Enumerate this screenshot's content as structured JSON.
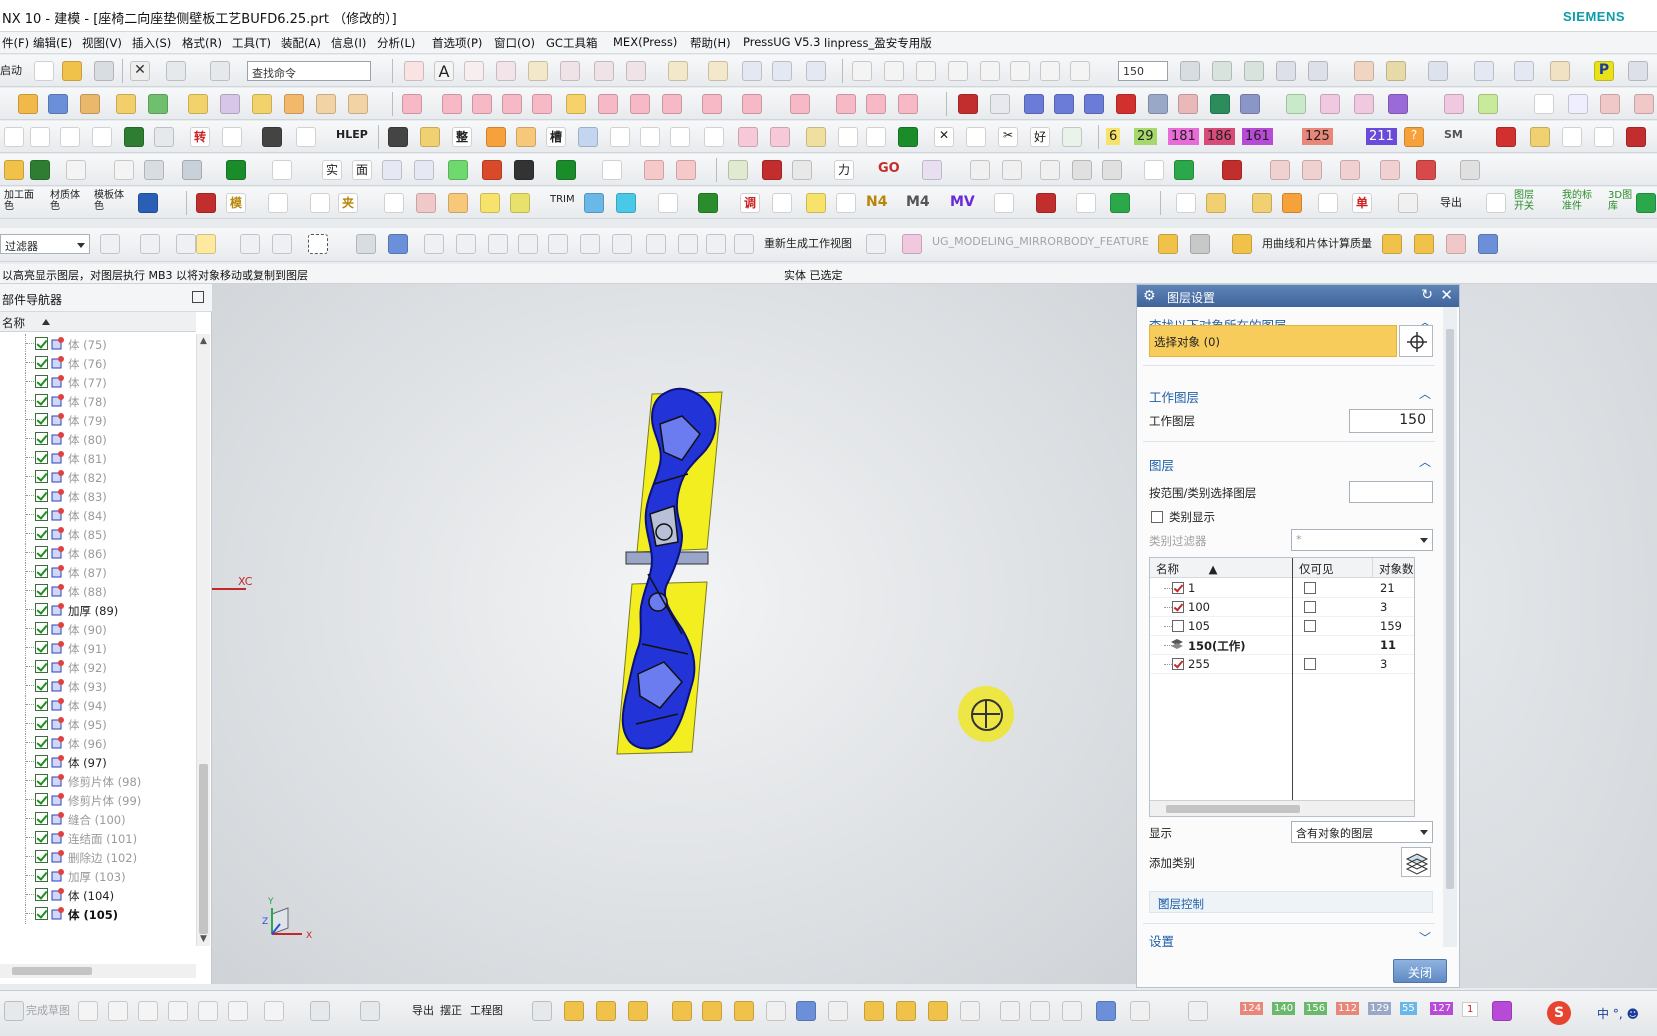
{
  "window": {
    "title": "NX 10 - 建模 - [座椅二向座垫侧壁板工艺BUFD6.25.prt （修改的）]",
    "brand": "SIEMENS"
  },
  "menu": [
    "件(F)",
    "编辑(E)",
    "视图(V)",
    "插入(S)",
    "格式(R)",
    "工具(T)",
    "装配(A)",
    "信息(I)",
    "分析(L)",
    "首选项(P)",
    "窗口(O)",
    "GC工具箱",
    "MEX(Press)",
    "帮助(H)",
    "PressUG V5.3",
    "linpress_盈安专用版"
  ],
  "toolbar": {
    "start_label": "启动",
    "command_search_placeholder": "查找命令",
    "work_layer_combo": "150",
    "filter_combo": "过滤器",
    "regenerate_label": "重新生成工作视图",
    "mirror_feature_label": "UG_MODELING_MIRRORBODY_FEATURE",
    "compute_mass_label": "用曲线和片体计算质量",
    "row2_labels": [
      "加工面色",
      "材质体色",
      "模板体色"
    ],
    "hlep_label": "HLEP",
    "n4": "N4",
    "m4": "M4",
    "mv": "MV",
    "go": "GO",
    "sm": "SM",
    "trim": "TRIM",
    "p": "P",
    "export_label": "导出",
    "layer_switch_label": "图层开关",
    "standard_label": "我的标准件",
    "lib3d_label": "3D图库",
    "numbers": [
      "6",
      "29",
      "181",
      "186",
      "161",
      "125",
      "211"
    ]
  },
  "status": {
    "message": "以高亮显示图层，对图层执行 MB3 以将对象移动或复制到图层",
    "selection": "实体 已选定"
  },
  "navigator": {
    "title": "部件导航器",
    "column": "名称",
    "items": [
      {
        "label": "体 (75)",
        "style": "dim"
      },
      {
        "label": "体 (76)",
        "style": "dim"
      },
      {
        "label": "体 (77)",
        "style": "dim"
      },
      {
        "label": "体 (78)",
        "style": "dim"
      },
      {
        "label": "体 (79)",
        "style": "dim"
      },
      {
        "label": "体 (80)",
        "style": "dim"
      },
      {
        "label": "体 (81)",
        "style": "dim"
      },
      {
        "label": "体 (82)",
        "style": "dim"
      },
      {
        "label": "体 (83)",
        "style": "dim"
      },
      {
        "label": "体 (84)",
        "style": "dim"
      },
      {
        "label": "体 (85)",
        "style": "dim"
      },
      {
        "label": "体 (86)",
        "style": "dim"
      },
      {
        "label": "体 (87)",
        "style": "dim"
      },
      {
        "label": "体 (88)",
        "style": "dim"
      },
      {
        "label": "加厚 (89)",
        "style": "normal"
      },
      {
        "label": "体 (90)",
        "style": "dim"
      },
      {
        "label": "体 (91)",
        "style": "dim"
      },
      {
        "label": "体 (92)",
        "style": "dim"
      },
      {
        "label": "体 (93)",
        "style": "dim"
      },
      {
        "label": "体 (94)",
        "style": "dim"
      },
      {
        "label": "体 (95)",
        "style": "dim"
      },
      {
        "label": "体 (96)",
        "style": "dim"
      },
      {
        "label": "体 (97)",
        "style": "normal"
      },
      {
        "label": "修剪片体 (98)",
        "style": "dim"
      },
      {
        "label": "修剪片体 (99)",
        "style": "dim"
      },
      {
        "label": "缝合 (100)",
        "style": "dim"
      },
      {
        "label": "连结面 (101)",
        "style": "dim"
      },
      {
        "label": "删除边 (102)",
        "style": "dim"
      },
      {
        "label": "加厚 (103)",
        "style": "dim"
      },
      {
        "label": "体 (104)",
        "style": "normal"
      },
      {
        "label": "体 (105)",
        "style": "bold"
      }
    ]
  },
  "viewport": {
    "wcs_label": "XC",
    "triad_x": "X",
    "triad_y": "Y",
    "triad_z": "Z"
  },
  "dialog": {
    "title": "图层设置",
    "find_section": "查找以下对象所在的图层",
    "select_object": "选择对象 (0)",
    "work_layer_section": "工作图层",
    "work_layer_label": "工作图层",
    "work_layer_value": "150",
    "layers_section": "图层",
    "range_label": "按范围/类别选择图层",
    "range_value": "",
    "category_display": "类别显示",
    "category_filter_label": "类别过滤器",
    "category_filter_value": "*",
    "table_headers": [
      "名称",
      "仅可见",
      "对象数"
    ],
    "layers": [
      {
        "name": "1",
        "checked": true,
        "visible_only": false,
        "count": "21"
      },
      {
        "name": "100",
        "checked": true,
        "visible_only": false,
        "count": "3"
      },
      {
        "name": "105",
        "checked": false,
        "visible_only": false,
        "count": "159"
      },
      {
        "name": "150(工作)",
        "checked": true,
        "visible_only": null,
        "count": "11"
      },
      {
        "name": "255",
        "checked": true,
        "visible_only": false,
        "count": "3"
      }
    ],
    "display_label": "显示",
    "display_value": "含有对象的图层",
    "add_category": "添加类别",
    "layer_control": "图层控制",
    "settings_section": "设置",
    "close_button": "关闭"
  },
  "bottombar": {
    "sketch_label": "完成草图",
    "export": "导出",
    "straighten": "摆正",
    "drawing": "工程图",
    "layer_numbers": [
      "124",
      "140",
      "156",
      "112",
      "129",
      "55",
      "127",
      "1"
    ],
    "ime": "中 °, ☻"
  },
  "colors": {
    "accent": "#1f5fa8",
    "dialog_header": "#4a6fa5",
    "selection_highlight": "#f7cc5b",
    "part_blue": "#2233d8",
    "part_yellow": "#f2ee20",
    "cursor_halo": "#eee628",
    "siemens": "#0b9da8"
  }
}
